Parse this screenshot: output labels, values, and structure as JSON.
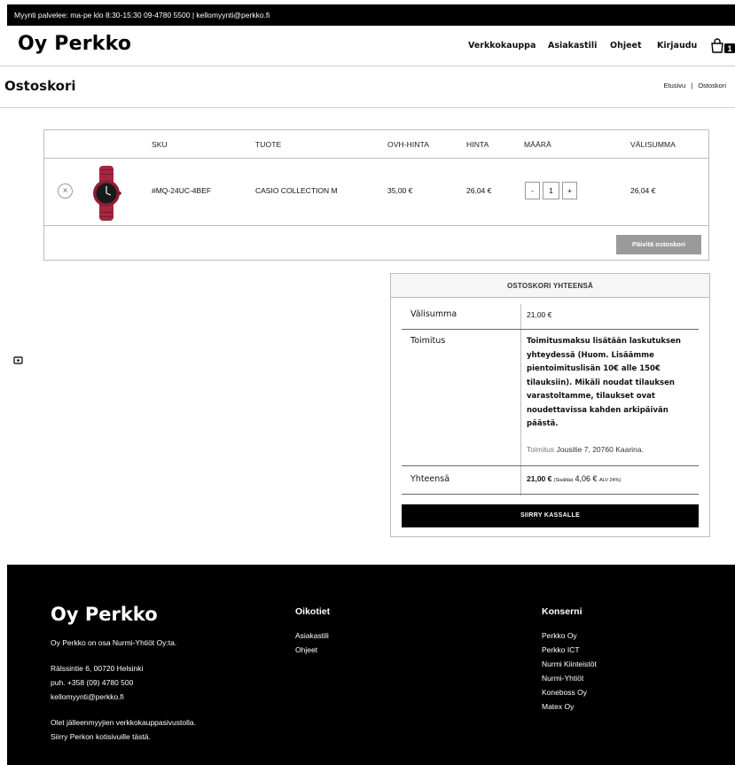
{
  "topbar": {
    "text": "Myynti palvelee: ma-pe klo 8:30-15:30    09-4780 5500 | kellomyynti@perkko.fi"
  },
  "header": {
    "logo": "Oy Perkko",
    "nav": [
      "Verkkokauppa",
      "Asiakastili",
      "Ohjeet",
      "Kirjaudu"
    ],
    "cart_count": "1",
    "icon": "shopping-bag-icon"
  },
  "page": {
    "title": "Ostoskori",
    "breadcrumb": [
      "Etusivu",
      "Ostoskori"
    ],
    "breadcrumb_sep": "|"
  },
  "cart": {
    "headers": {
      "sku": "SKU",
      "product": "TUOTE",
      "list_price": "OVH-HINTA",
      "price": "HINTA",
      "quantity": "MÄÄRÄ",
      "subtotal": "VÄLISUMMA"
    },
    "items": [
      {
        "remove": "×",
        "sku": "#MQ-24UC-4BEF",
        "product": "CASIO COLLECTION M",
        "list_price": "35,00 €",
        "price": "26,04 €",
        "qty_minus": "-",
        "quantity": "1",
        "qty_plus": "+",
        "subtotal": "26,04 €"
      }
    ],
    "update_button": "Päivitä ostoskori"
  },
  "totals": {
    "heading": "OSTOSKORI YHTEENSÄ",
    "subtotal_label": "Välisumma",
    "subtotal_value": "21,00 €",
    "shipping_label": "Toimitus",
    "shipping_note": "Toimitusmaksu lisätään laskutuksen yhteydessä (Huom. Lisäämme pientoimituslisän 10€ alle 150€ tilauksiin). Mikäli noudat tilauksen varastoltamme, tilaukset ovat noudettavissa kahden arkipäivän päästä.",
    "shipping_to_label": "Toimitus",
    "shipping_to_address": "Jousitie 7, 20760 Kaarina.",
    "total_label": "Yhteensä",
    "total_value": "21,00 €",
    "tax_prefix": "(Sisältää",
    "tax_amount": "4,06 €",
    "tax_suffix": "ALV 24%)",
    "checkout_button": "SIIRRY KASSALLE"
  },
  "footer": {
    "logo": "Oy Perkko",
    "about": "Oy Perkko on osa Nurmi-Yhtiöt Oy:ta.",
    "address": "Rälssintie 6, 00720 Helsinki",
    "phone": "puh. +358 (09) 4780 500",
    "email": "kellomyynti@perkko.fi",
    "reseller_note": "Olet jälleenmyyjien verkkokauppasivustolla. Siirry Perkon kotisivuille tästä.",
    "shortcuts_heading": "Oikotiet",
    "shortcuts": [
      "Asiakastili",
      "Ohjeet"
    ],
    "group_heading": "Konserni",
    "group": [
      "Perkko Oy",
      "Perkko ICT",
      "Nurmi Kiinteistöt",
      "Nurmi-Yhtiöt",
      "Koneboss Oy",
      "Matex Oy"
    ]
  }
}
